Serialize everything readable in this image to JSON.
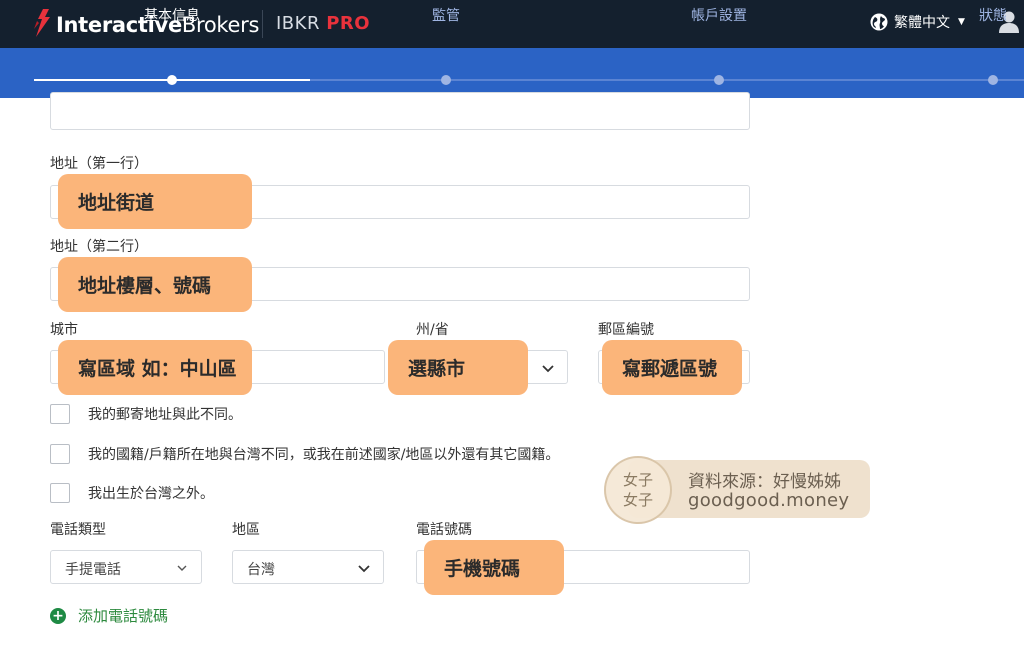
{
  "header": {
    "brand_bold": "Interactive",
    "brand_rest": "Brokers",
    "product_main": "IBKR",
    "product_tier": "PRO",
    "language": "繁體中文",
    "language_icon": "globe-icon",
    "user_icon": "user-icon"
  },
  "stepper": {
    "steps": [
      {
        "label": "基本信息",
        "active": true
      },
      {
        "label": "監管",
        "active": false
      },
      {
        "label": "帳戶設置",
        "active": false
      },
      {
        "label": "狀態",
        "active": false
      }
    ]
  },
  "form": {
    "address1": {
      "label": "地址（第一行）",
      "value": ""
    },
    "address2": {
      "label": "地址（第二行）",
      "value": ""
    },
    "city": {
      "label": "城市",
      "value": ""
    },
    "state": {
      "label": "州/省",
      "value": ""
    },
    "postal": {
      "label": "郵區編號",
      "value": ""
    },
    "checkboxes": [
      {
        "label": "我的郵寄地址與此不同。",
        "checked": false
      },
      {
        "label": "我的國籍/戶籍所在地與台灣不同，或我在前述國家/地區以外還有其它國籍。",
        "checked": false
      },
      {
        "label": "我出生於台灣之外。",
        "checked": false
      }
    ],
    "phone_type": {
      "label": "電話類型",
      "value": "手提電話"
    },
    "region": {
      "label": "地區",
      "value": "台灣"
    },
    "phone_number": {
      "label": "電話號碼",
      "value": ""
    },
    "add_phone": "添加電話號碼"
  },
  "annotations": {
    "address1": "地址街道",
    "address2": "地址樓層、號碼",
    "city": "寫區域 如：中山區",
    "state": "選縣市",
    "postal": "寫郵遞區號",
    "phone": "手機號碼"
  },
  "watermark": {
    "logo_top": "女子",
    "logo_bottom": "女子",
    "source": "資料來源：好慢姊姊",
    "site": "goodgood.money"
  },
  "colors": {
    "header_bg": "#14202e",
    "stepper_bg": "#2b63c5",
    "brand_red": "#e8323c",
    "callout": "#fbb57a",
    "add_green": "#2d8a3e"
  }
}
